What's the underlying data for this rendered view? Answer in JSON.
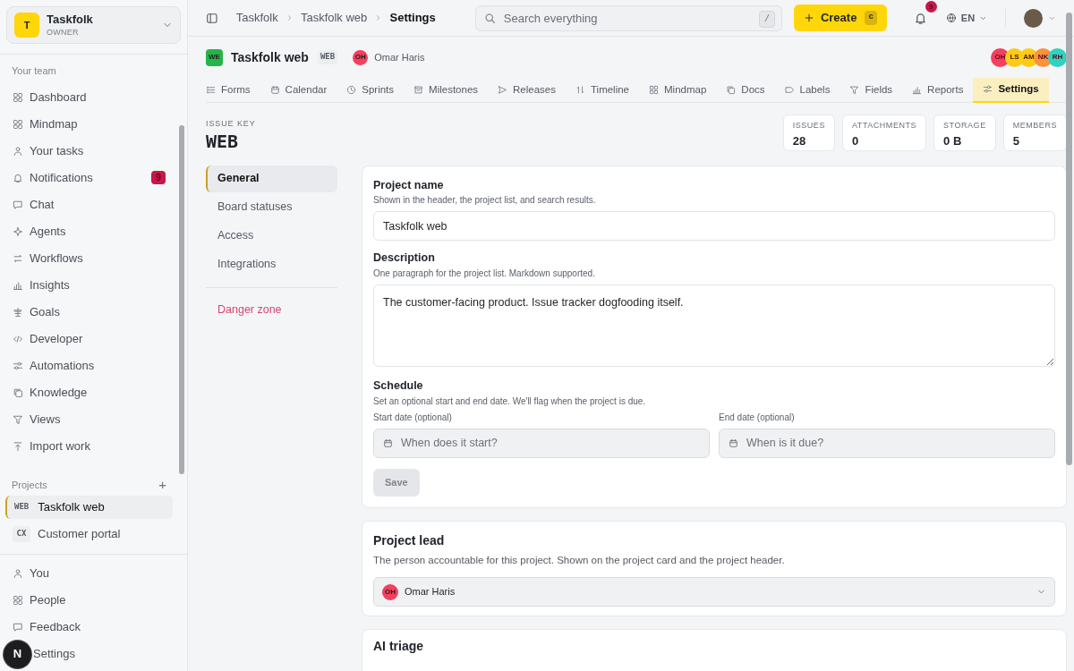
{
  "workspace": {
    "initial": "T",
    "name": "Taskfolk",
    "role": "OWNER"
  },
  "sidebar": {
    "team_heading": "Your team",
    "items": [
      {
        "label": "Dashboard",
        "selected": false
      },
      {
        "label": "Mindmap",
        "selected": false
      },
      {
        "label": "Your tasks",
        "selected": false
      },
      {
        "label": "Notifications",
        "selected": false,
        "badge": "9"
      },
      {
        "label": "Chat",
        "selected": false
      },
      {
        "label": "Agents",
        "selected": false
      },
      {
        "label": "Workflows",
        "selected": false
      },
      {
        "label": "Insights",
        "selected": false
      },
      {
        "label": "Goals",
        "selected": false
      },
      {
        "label": "Developer",
        "selected": false
      },
      {
        "label": "Automations",
        "selected": false
      },
      {
        "label": "Knowledge",
        "selected": false
      },
      {
        "label": "Views",
        "selected": false
      },
      {
        "label": "Import work",
        "selected": false
      }
    ],
    "projects_heading": "Projects",
    "add_button": "+",
    "projects": [
      {
        "key": "WEB",
        "name": "Taskfolk web",
        "selected": true
      },
      {
        "key": "CX",
        "name": "Customer portal",
        "selected": false
      }
    ],
    "bottom_items": [
      {
        "label": "You"
      },
      {
        "label": "People"
      },
      {
        "label": "Feedback"
      },
      {
        "label": "Settings"
      }
    ],
    "dev_button": "N"
  },
  "topbar": {
    "breadcrumbs": [
      {
        "label": "Taskfolk",
        "selected": false
      },
      {
        "label": "Taskfolk web",
        "selected": false
      },
      {
        "label": "Settings",
        "selected": true
      }
    ],
    "search": {
      "placeholder": "Search everything",
      "shortcut": "/"
    },
    "create": {
      "label": "Create",
      "shortcut": "c"
    },
    "notifications_badge": "9",
    "language": "EN"
  },
  "project": {
    "badge": "WE",
    "name": "Taskfolk web",
    "key": "WEB",
    "lead_initials": "OH",
    "lead": "Omar Haris",
    "members": [
      {
        "initials": "OH",
        "color": "#f43f5e"
      },
      {
        "initials": "LS",
        "color": "#facc15"
      },
      {
        "initials": "AM",
        "color": "#facc15"
      },
      {
        "initials": "NK",
        "color": "#fb923c"
      },
      {
        "initials": "RH",
        "color": "#2dd4bf"
      }
    ]
  },
  "tabs": [
    {
      "label": "Forms",
      "selected": false
    },
    {
      "label": "Calendar",
      "selected": false
    },
    {
      "label": "Sprints",
      "selected": false
    },
    {
      "label": "Milestones",
      "selected": false
    },
    {
      "label": "Releases",
      "selected": false
    },
    {
      "label": "Timeline",
      "selected": false
    },
    {
      "label": "Mindmap",
      "selected": false
    },
    {
      "label": "Docs",
      "selected": false
    },
    {
      "label": "Labels",
      "selected": false
    },
    {
      "label": "Fields",
      "selected": false
    },
    {
      "label": "Reports",
      "selected": false
    },
    {
      "label": "Settings",
      "selected": true
    }
  ],
  "issue_key": {
    "label": "ISSUE KEY",
    "value": "WEB"
  },
  "stats": [
    {
      "label": "ISSUES",
      "value": "28"
    },
    {
      "label": "ATTACHMENTS",
      "value": "0"
    },
    {
      "label": "STORAGE",
      "value": "0 B"
    },
    {
      "label": "MEMBERS",
      "value": "5"
    }
  ],
  "settings_nav": [
    {
      "label": "General",
      "selected": true,
      "kind": "normal"
    },
    {
      "label": "Board statuses",
      "selected": false,
      "kind": "normal"
    },
    {
      "label": "Access",
      "selected": false,
      "kind": "normal"
    },
    {
      "label": "Integrations",
      "selected": false,
      "kind": "normal"
    },
    {
      "label": "Danger zone",
      "selected": false,
      "kind": "danger"
    }
  ],
  "general": {
    "name_label": "Project name",
    "name_hint": "Shown in the header, the project list, and search results.",
    "name_value": "Taskfolk web",
    "description_label": "Description",
    "description_hint": "One paragraph for the project list. Markdown supported.",
    "description_value": "The customer-facing product. Issue tracker dogfooding itself.",
    "schedule_label": "Schedule",
    "schedule_hint": "Set an optional start and end date. We'll flag when the project is due.",
    "start_label": "Start date (optional)",
    "start_placeholder": "When does it start?",
    "end_label": "End date (optional)",
    "end_placeholder": "When is it due?",
    "save": {
      "label": "Save",
      "disabled": true
    }
  },
  "lead_card": {
    "title": "Project lead",
    "hint": "The person accountable for this project. Shown on the project card and the project header.",
    "initials": "OH",
    "value": "Omar Haris"
  },
  "ai_card": {
    "title": "AI triage"
  }
}
